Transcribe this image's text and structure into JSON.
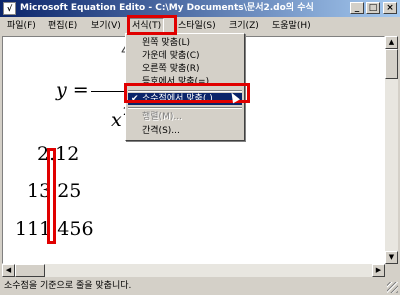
{
  "window": {
    "title": "Microsoft Equation Edito - C:\\My Documents\\문서2.do의 수식"
  },
  "menubar": [
    {
      "label": "파일(F)"
    },
    {
      "label": "편집(E)"
    },
    {
      "label": "보기(V)"
    },
    {
      "label": "서식(T)"
    },
    {
      "label": "스타일(S)"
    },
    {
      "label": "크기(Z)"
    },
    {
      "label": "도움말(H)"
    }
  ],
  "format_menu": {
    "items": [
      {
        "label": "왼쪽 맞춤(L)",
        "state": "enabled"
      },
      {
        "label": "가운데 맞춤(C)",
        "state": "enabled"
      },
      {
        "label": "오른쪽 맞춤(R)",
        "state": "enabled"
      },
      {
        "label": "등호에서 맞춤(=)",
        "state": "enabled"
      },
      {
        "label": "소수점에서 맞춤(.)",
        "state": "selected",
        "checked": true
      },
      {
        "label": "행렬(M)...",
        "state": "disabled"
      },
      {
        "label": "간격(S)...",
        "state": "enabled"
      }
    ]
  },
  "equation": {
    "lhs": "y =",
    "numerator_fragment": "4",
    "denominator_fragment": "x",
    "denominator_exponent": "2",
    "numbers": [
      "2.12",
      "13.25",
      "111.456"
    ]
  },
  "statusbar": {
    "text": "소수점을 기준으로 줄을 맞춥니다."
  },
  "colors": {
    "titlebar_start": "#0a246a",
    "titlebar_end": "#a6caf0",
    "highlight": "#e00000",
    "menu_selected": "#0a246a"
  }
}
